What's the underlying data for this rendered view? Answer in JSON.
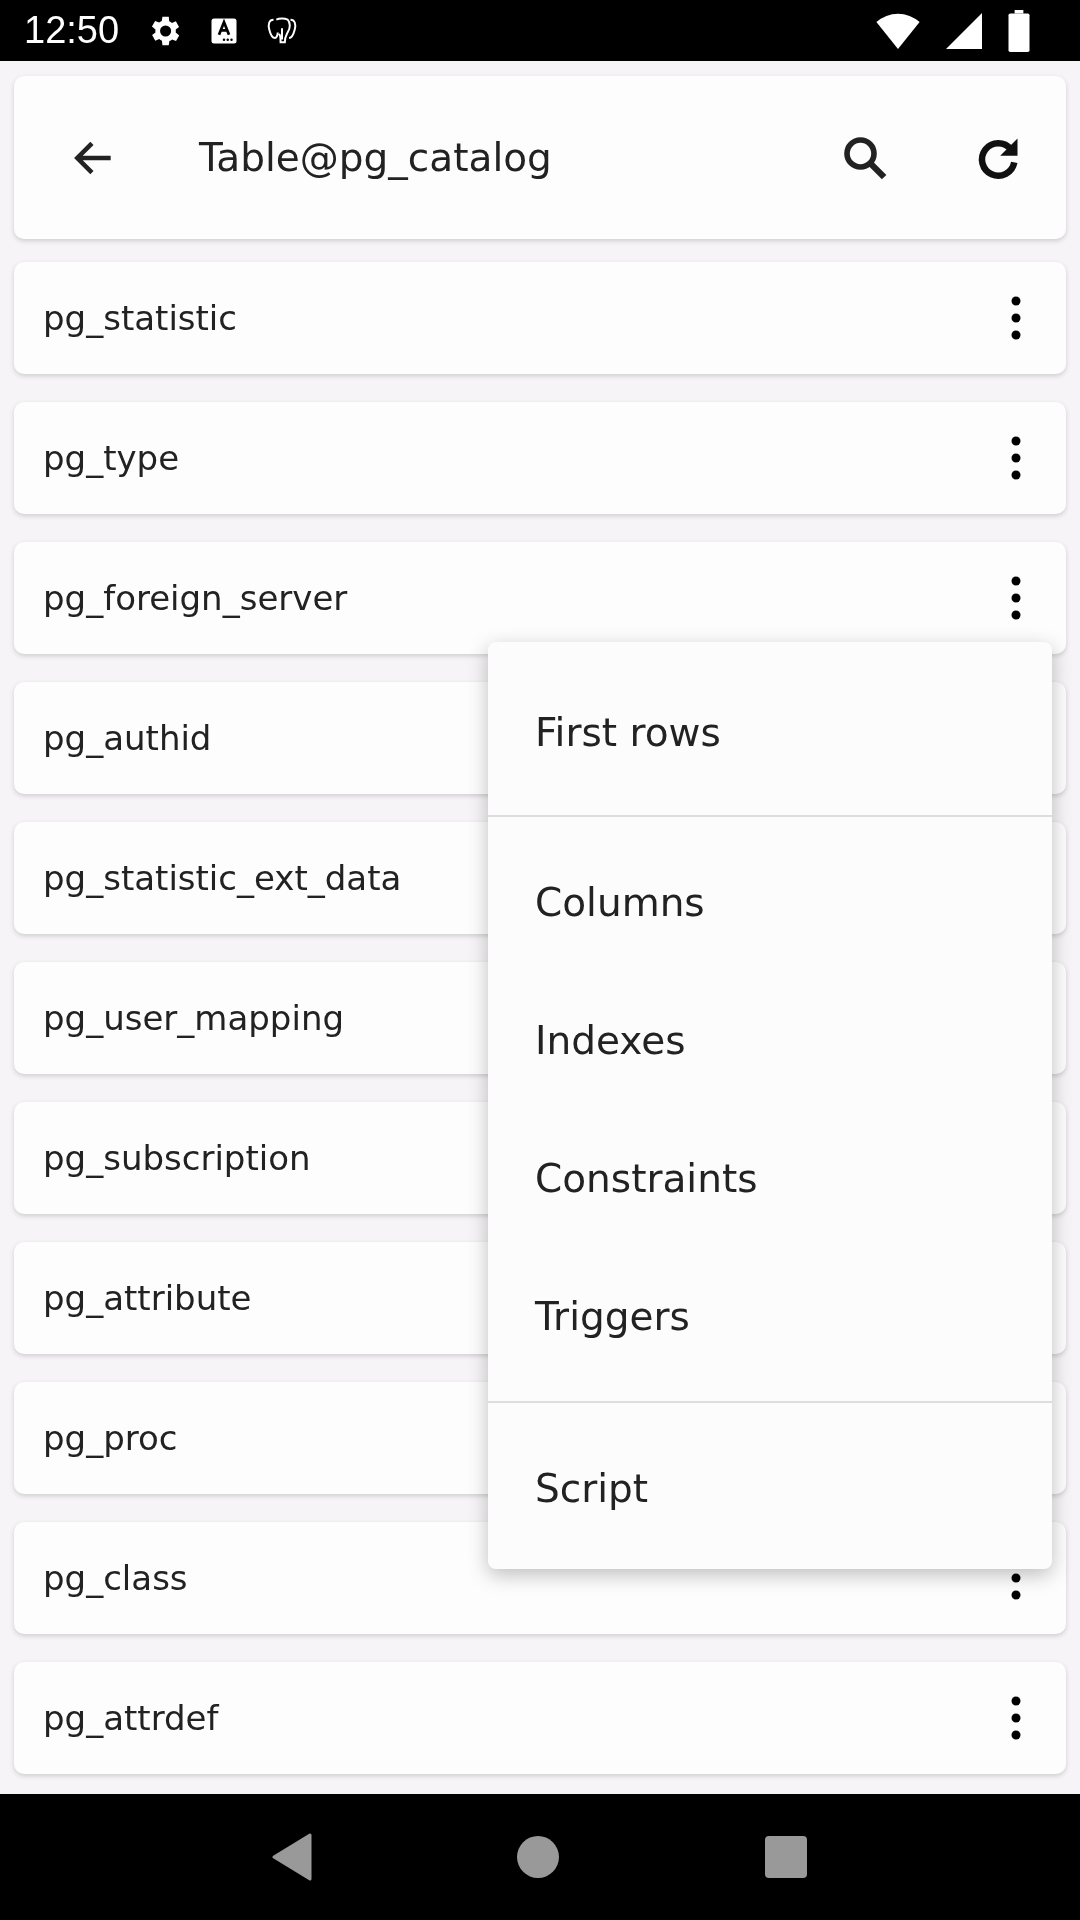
{
  "status_bar": {
    "time": "12:50"
  },
  "header": {
    "title": "Table@pg_catalog"
  },
  "tables": [
    {
      "name": "pg_statistic"
    },
    {
      "name": "pg_type"
    },
    {
      "name": "pg_foreign_server"
    },
    {
      "name": "pg_authid"
    },
    {
      "name": "pg_statistic_ext_data"
    },
    {
      "name": "pg_user_mapping"
    },
    {
      "name": "pg_subscription"
    },
    {
      "name": "pg_attribute"
    },
    {
      "name": "pg_proc"
    },
    {
      "name": "pg_class"
    },
    {
      "name": "pg_attrdef"
    }
  ],
  "menu": {
    "sections": [
      {
        "items": [
          "First rows"
        ]
      },
      {
        "items": [
          "Columns",
          "Indexes",
          "Constraints",
          "Triggers"
        ]
      },
      {
        "items": [
          "Script"
        ]
      }
    ]
  }
}
